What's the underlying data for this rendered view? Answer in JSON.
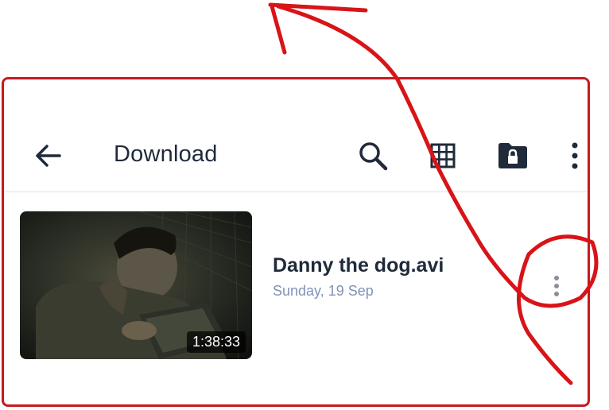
{
  "header": {
    "title": "Download"
  },
  "icons": {
    "back": "arrow-left-icon",
    "search": "search-icon",
    "grid": "grid-view-icon",
    "lock": "lock-folder-icon",
    "more": "more-vertical-icon"
  },
  "items": [
    {
      "name": "Danny the dog.avi",
      "date": "Sunday, 19 Sep",
      "duration": "1:38:33"
    }
  ],
  "colors": {
    "annotation": "#c8191e",
    "title_text": "#1f2a3a",
    "date_text": "#7f93b8"
  }
}
